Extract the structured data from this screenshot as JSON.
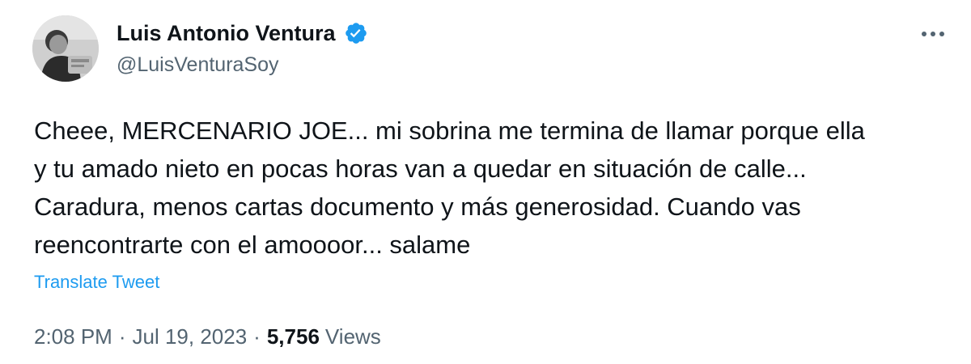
{
  "author": {
    "display_name": "Luis Antonio Ventura",
    "handle": "@LuisVenturaSoy",
    "verified": true,
    "verified_color": "#1d9bf0"
  },
  "tweet": {
    "lines": [
      "Cheee, MERCENARIO JOE... mi sobrina me termina de llamar porque ella",
      "y tu amado nieto en pocas horas van a quedar en situación de calle...",
      "Caradura, menos cartas documento y más generosidad. Cuando vas",
      "reencontrarte con el amoooor... salame"
    ],
    "translate_label": "Translate Tweet"
  },
  "meta": {
    "time": "2:08 PM",
    "separator": "·",
    "date": "Jul 19, 2023",
    "views_count": "5,756",
    "views_label": "Views"
  },
  "icons": {
    "more": "more-horizontal-icon",
    "verified": "verified-badge-icon",
    "avatar": "profile-photo"
  },
  "colors": {
    "text_primary": "#0f1419",
    "text_secondary": "#536471",
    "link": "#1d9bf0"
  }
}
